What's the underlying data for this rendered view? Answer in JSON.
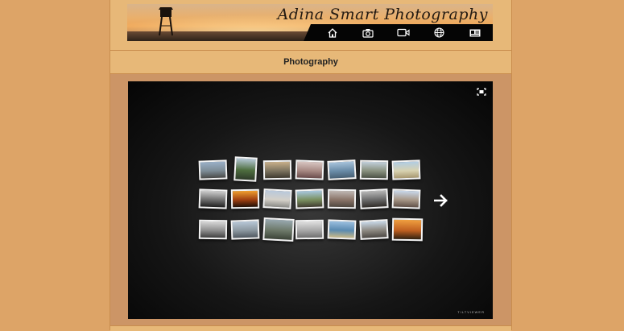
{
  "site": {
    "title": "Adina Smart Photography",
    "nav": [
      {
        "icon": "home-icon"
      },
      {
        "icon": "camera-icon"
      },
      {
        "icon": "video-camera-icon"
      },
      {
        "icon": "globe-icon"
      },
      {
        "icon": "contact-card-icon"
      }
    ]
  },
  "page": {
    "heading": "Photography"
  },
  "viewer": {
    "brand": "TILTVIEWER",
    "fullscreen_icon": "fullscreen-icon",
    "next_icon": "arrow-right-icon",
    "thumbnails": [
      {
        "row": 1,
        "col": 1,
        "colors": [
          "#9ab0c8",
          "#7d8c96",
          "#4a4a48"
        ]
      },
      {
        "row": 1,
        "col": 2,
        "colors": [
          "#b7c9d8",
          "#4e6e3f",
          "#2e3b2a"
        ]
      },
      {
        "row": 1,
        "col": 3,
        "colors": [
          "#c9b08a",
          "#7d7460",
          "#3f3a30"
        ]
      },
      {
        "row": 1,
        "col": 4,
        "colors": [
          "#d8c6c2",
          "#a88a84",
          "#6a4c4c"
        ]
      },
      {
        "row": 1,
        "col": 5,
        "colors": [
          "#a8c4dc",
          "#6a8ca8",
          "#486074"
        ]
      },
      {
        "row": 1,
        "col": 6,
        "colors": [
          "#c2d0dc",
          "#8a9280",
          "#4c5246"
        ]
      },
      {
        "row": 1,
        "col": 7,
        "colors": [
          "#b0cce4",
          "#d8d2b0",
          "#a89870"
        ]
      },
      {
        "row": 2,
        "col": 1,
        "colors": [
          "#d0d0d0",
          "#707070",
          "#202020"
        ]
      },
      {
        "row": 2,
        "col": 2,
        "colors": [
          "#f0a030",
          "#a04010",
          "#201008"
        ]
      },
      {
        "row": 2,
        "col": 3,
        "colors": [
          "#b8c8dc",
          "#d4d0c8",
          "#8a8a86"
        ]
      },
      {
        "row": 2,
        "col": 4,
        "colors": [
          "#a8c8e0",
          "#7a9060",
          "#403c30"
        ]
      },
      {
        "row": 2,
        "col": 5,
        "colors": [
          "#c0b8b4",
          "#8a7468",
          "#504840"
        ]
      },
      {
        "row": 2,
        "col": 6,
        "colors": [
          "#b8b8b8",
          "#6a6a6a",
          "#302c28"
        ]
      },
      {
        "row": 2,
        "col": 7,
        "colors": [
          "#c8d8ec",
          "#a89888",
          "#605048"
        ]
      },
      {
        "row": 3,
        "col": 1,
        "colors": [
          "#d8d8d8",
          "#909090",
          "#404040"
        ]
      },
      {
        "row": 3,
        "col": 2,
        "colors": [
          "#b8c8d8",
          "#8c98a0",
          "#505860"
        ]
      },
      {
        "row": 3,
        "col": 3,
        "colors": [
          "#98a8b0",
          "#6c7868",
          "#3c4438"
        ]
      },
      {
        "row": 3,
        "col": 4,
        "colors": [
          "#e0e0e0",
          "#a8a8a8",
          "#707070"
        ]
      },
      {
        "row": 3,
        "col": 5,
        "colors": [
          "#9cc0e0",
          "#5a8ab0",
          "#c8b888"
        ]
      },
      {
        "row": 3,
        "col": 6,
        "colors": [
          "#c8d8e8",
          "#8c8880",
          "#4c4844"
        ]
      },
      {
        "row": 3,
        "col": 7,
        "colors": [
          "#f0a040",
          "#c06020",
          "#302010"
        ]
      }
    ]
  }
}
